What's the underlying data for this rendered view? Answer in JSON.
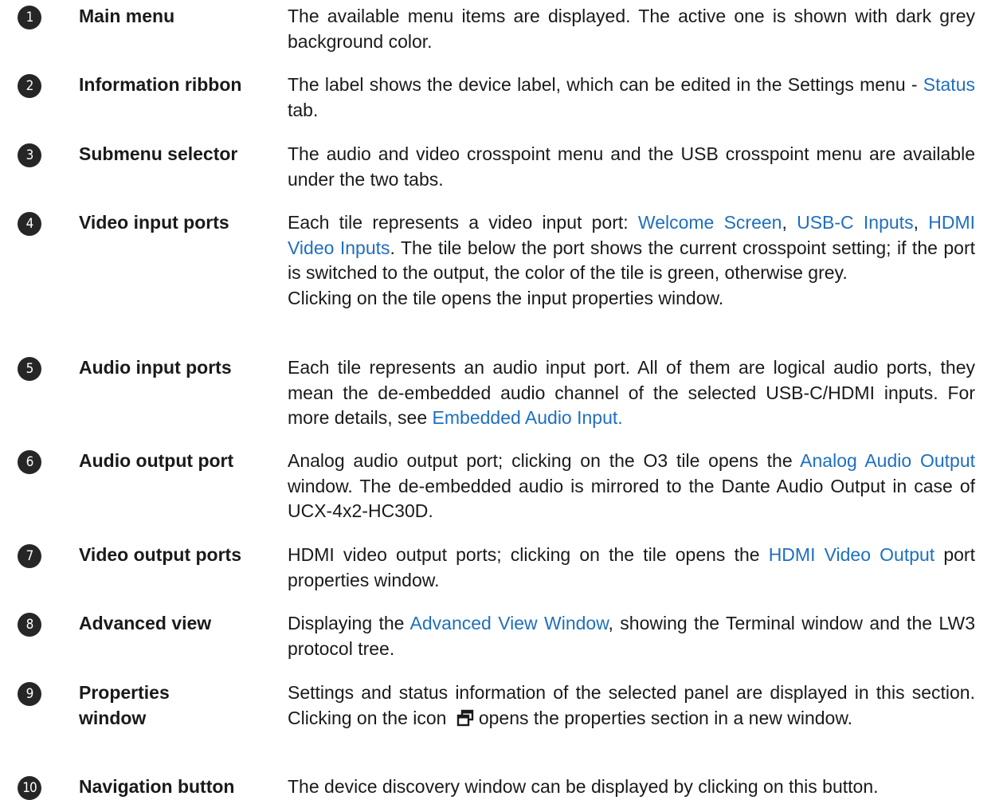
{
  "rows": [
    {
      "num": "1",
      "term": "Main menu",
      "desc": [
        "The available menu items are displayed. The active one is shown with dark grey background color."
      ]
    },
    {
      "num": "2",
      "term": "Information ribbon",
      "desc": [
        "The label shows the device label, which can be edited in the Settings menu - ",
        "Status",
        " tab."
      ]
    },
    {
      "num": "3",
      "term": "Submenu selector",
      "desc": [
        "The audio and video crosspoint menu and the USB crosspoint menu are available under the two tabs."
      ]
    },
    {
      "num": "4",
      "term": "Video input ports",
      "desc": [
        "Each tile represents a video input port: ",
        "Welcome Screen",
        ", ",
        "USB-C Inputs",
        ", ",
        "HDMI Video Inputs",
        ". The tile below the port shows the current crosspoint setting; if the port is switched to the output, the color of the tile is green, otherwise grey."
      ],
      "desc2": "Clicking on the tile opens the input properties window."
    },
    {
      "num": "5",
      "term": "Audio input ports",
      "desc": [
        "Each tile represents an audio input port. All of them are logical audio ports, they mean the de-embedded audio channel of the selected USB-C/HDMI inputs. For more details, see ",
        "Embedded Audio Input."
      ]
    },
    {
      "num": "6",
      "term": "Audio output port",
      "desc": [
        "Analog audio output port; clicking on the O3 tile opens the ",
        "Analog Audio Output",
        " window. The de-embedded audio is mirrored to the Dante Audio Output in case of UCX-4x2-HC30D."
      ]
    },
    {
      "num": "7",
      "term": "Video output ports",
      "desc": [
        "HDMI video output ports; clicking on the tile opens the ",
        "HDMI Video Output",
        " port properties window."
      ]
    },
    {
      "num": "8",
      "term": "Advanced view",
      "desc": [
        "Displaying the ",
        "Advanced View Window",
        ", showing the Terminal window and the LW3 protocol tree."
      ]
    },
    {
      "num": "9",
      "term": "Properties window",
      "desc": [
        "Settings and status information of the selected panel are displayed in this section. Clicking on the icon",
        "opens the properties section in a new window."
      ],
      "icon": "open-in-new-window-icon"
    },
    {
      "num": "10",
      "term": "Navigation button",
      "desc": [
        "The device discovery window can be displayed by clicking on this button."
      ]
    }
  ],
  "colors": {
    "link": "#1f6fbf",
    "badge": "#262626",
    "text": "#1a1a1a"
  }
}
